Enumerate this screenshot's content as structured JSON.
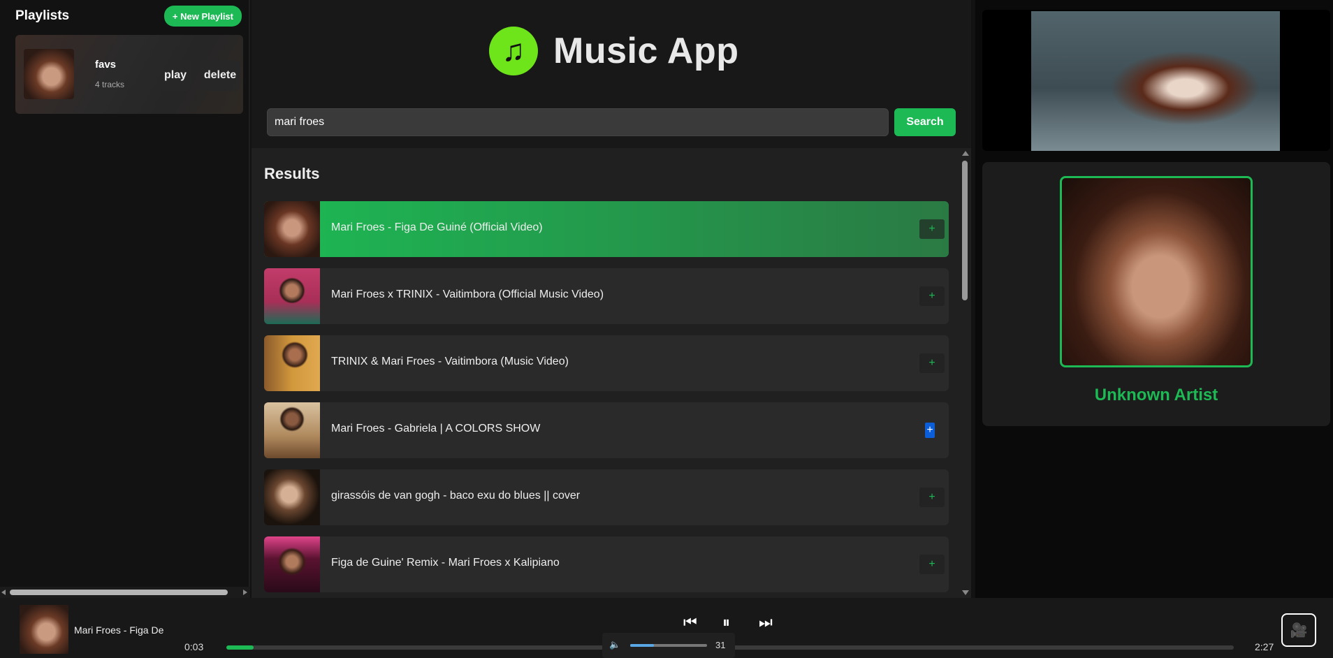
{
  "sidebar": {
    "title": "Playlists",
    "new_playlist_label": "+ New Playlist",
    "playlists": [
      {
        "name": "favs",
        "count": "4 tracks",
        "play_label": "play",
        "delete_label": "delete"
      }
    ]
  },
  "header": {
    "app_title": "Music App",
    "logo_icon": "music-note-icon"
  },
  "search": {
    "value": "mari froes",
    "button_label": "Search"
  },
  "results": {
    "title": "Results",
    "add_label": "+",
    "items": [
      {
        "title": "Mari Froes - Figa De Guiné (Official Video)",
        "active": true
      },
      {
        "title": "Mari Froes x TRINIX - Vaitimbora (Official Music Video)"
      },
      {
        "title": "TRINIX & Mari Froes - Vaitimbora (Music Video)"
      },
      {
        "title": "Mari Froes - Gabriela | A COLORS SHOW"
      },
      {
        "title": "girassóis de van gogh - baco exu do blues || cover"
      },
      {
        "title": "Figa de Guine' Remix - Mari Froes x Kalipiano"
      }
    ]
  },
  "artist_panel": {
    "artist_name": "Unknown Artist"
  },
  "player": {
    "now_playing_title": "Mari Froes - Figa De",
    "current_time": "0:03",
    "total_time": "2:27",
    "progress": 0.027,
    "volume": "31",
    "volume_level": 0.31,
    "prev_icon": "previous-icon",
    "pause_icon": "pause-icon",
    "next_icon": "next-icon"
  },
  "colors": {
    "accent": "#1db954",
    "logo": "#6ee51a",
    "background": "#121212"
  }
}
